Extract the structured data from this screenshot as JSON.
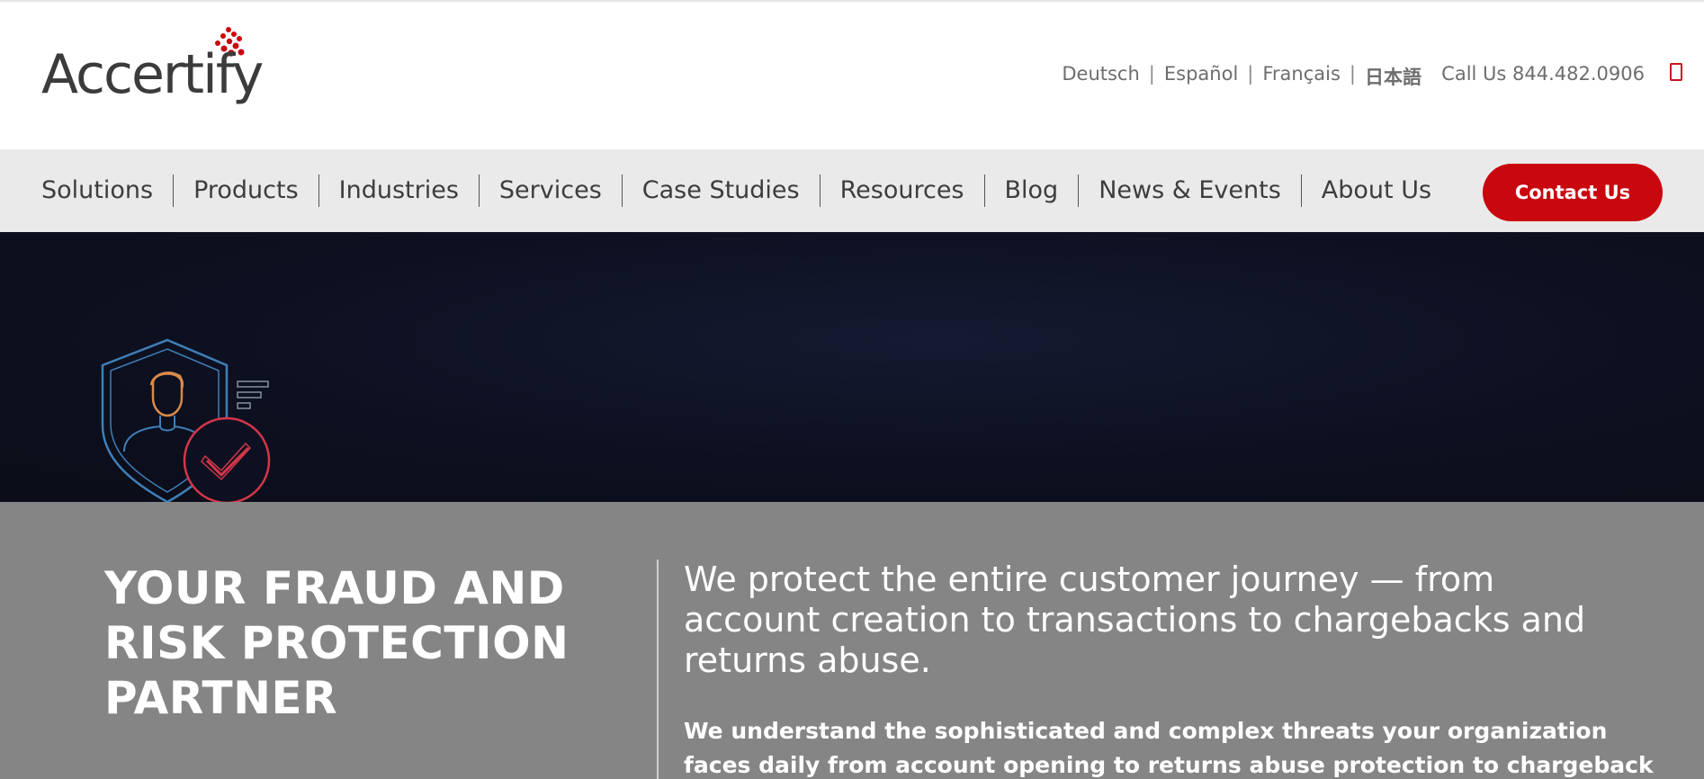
{
  "header": {
    "logo_text": "Accertify",
    "languages": [
      "Deutsch",
      "Español",
      "Français",
      "日本語"
    ],
    "language_separator": "|",
    "call_us": "Call Us 844.482.0906",
    "search_icon": "search-icon"
  },
  "nav": {
    "items": [
      "Solutions",
      "Products",
      "Industries",
      "Services",
      "Case Studies",
      "Resources",
      "Blog",
      "News & Events",
      "About Us"
    ],
    "contact_label": "Contact Us"
  },
  "hero": {
    "icon": "shield-user-check-icon"
  },
  "band": {
    "headline": "YOUR FRAUD AND RISK PROTECTION PARTNER",
    "lead": "We protect the entire customer journey — from account creation to transactions to chargebacks and returns abuse.",
    "sub": "We understand the sophisticated and complex threats your organization faces daily from account opening to returns abuse protection to chargeback"
  },
  "colors": {
    "brand_red": "#c9070f",
    "nav_bg": "#ebeaea",
    "band_bg": "#858585",
    "hero_bg": "#0d1020"
  }
}
